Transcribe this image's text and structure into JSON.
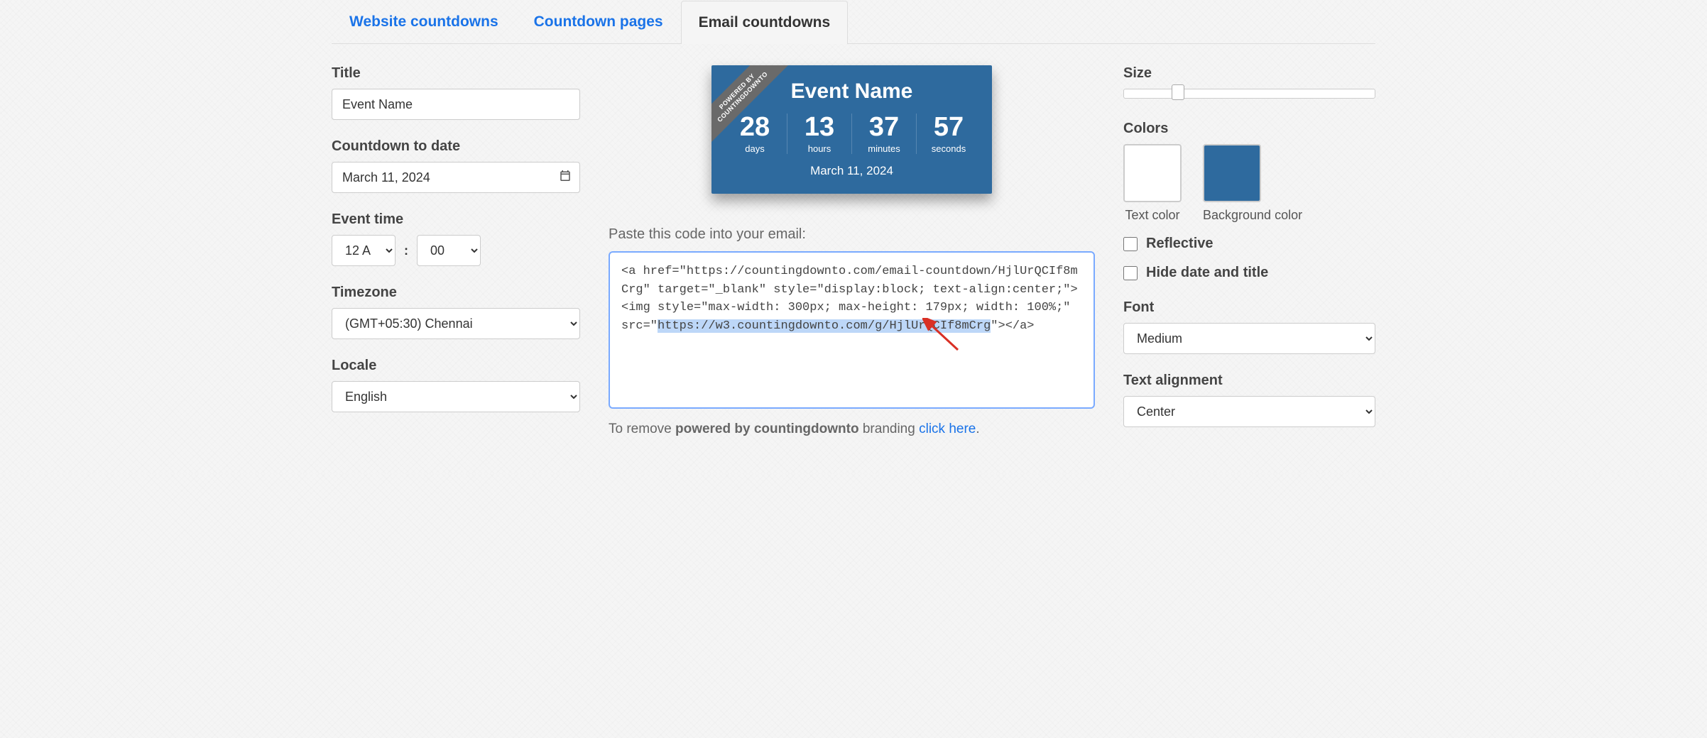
{
  "tabs": {
    "website": "Website countdowns",
    "pages": "Countdown pages",
    "email": "Email countdowns"
  },
  "left": {
    "title_label": "Title",
    "title_value": "Event Name",
    "countdown_date_label": "Countdown to date",
    "countdown_date_value": "March 11, 2024",
    "event_time_label": "Event time",
    "hour_value": "12 A",
    "minute_value": "00",
    "timezone_label": "Timezone",
    "timezone_value": "(GMT+05:30) Chennai",
    "locale_label": "Locale",
    "locale_value": "English"
  },
  "preview": {
    "ribbon_line1": "POWERED BY",
    "ribbon_line2": "COUNTINGDOWNTO",
    "title": "Event Name",
    "days_value": "28",
    "days_label": "days",
    "hours_value": "13",
    "hours_label": "hours",
    "minutes_value": "37",
    "minutes_label": "minutes",
    "seconds_value": "57",
    "seconds_label": "seconds",
    "date": "March 11, 2024"
  },
  "code": {
    "label": "Paste this code into your email:",
    "part1": "<a href=\"https://countingdownto.com/email-countdown/HjlUrQCIf8mCrg\" target=\"_blank\" style=\"display:block; text-align:center;\"><img style=\"max-width: 300px; max-height: 179px; width: 100%;\" src=\"",
    "highlight": "https://w3.countingdownto.com/g/HjlUrQCIf8mCrg",
    "part2": "\"></a>"
  },
  "branding": {
    "text1": "To remove ",
    "bold": "powered by countingdownto",
    "text2": " branding ",
    "link": "click here",
    "dot": "."
  },
  "right": {
    "size_label": "Size",
    "colors_label": "Colors",
    "text_color_label": "Text color",
    "text_color": "#ffffff",
    "bg_color_label": "Background color",
    "bg_color": "#2e6a9e",
    "reflective_label": "Reflective",
    "hide_date_label": "Hide date and title",
    "font_label": "Font",
    "font_value": "Medium",
    "align_label": "Text alignment",
    "align_value": "Center"
  }
}
